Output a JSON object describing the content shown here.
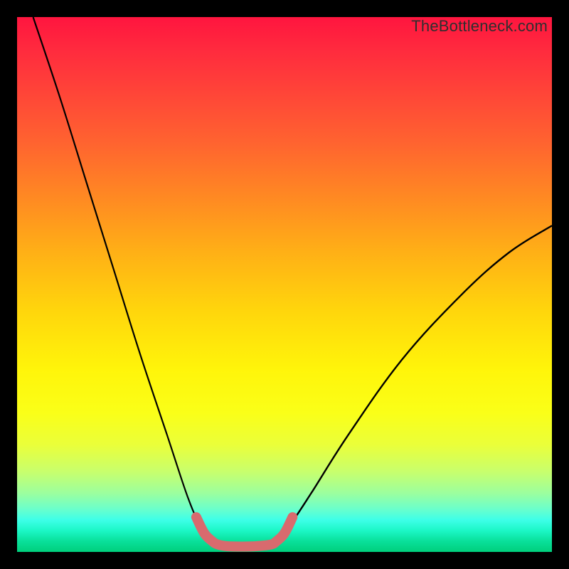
{
  "watermark": "TheBottleneck.com",
  "chart_data": {
    "type": "line",
    "title": "",
    "xlabel": "",
    "ylabel": "",
    "xlim": [
      0,
      100
    ],
    "ylim": [
      0,
      100
    ],
    "grid": false,
    "legend": false,
    "series": [
      {
        "name": "left-curve",
        "color": "#000000",
        "x": [
          3,
          8,
          13,
          18,
          23,
          28,
          32,
          34.5,
          36.5,
          37.5
        ],
        "y": [
          100,
          85,
          69,
          53,
          37,
          22,
          10,
          4.5,
          2.2,
          1.4
        ]
      },
      {
        "name": "right-curve",
        "color": "#000000",
        "x": [
          47.5,
          48.5,
          51,
          55,
          62,
          72,
          83,
          92,
          100
        ],
        "y": [
          1.4,
          2.2,
          5,
          11,
          22,
          36,
          48,
          56,
          61
        ]
      },
      {
        "name": "optimal-band",
        "color": "#d86a6e",
        "x": [
          33.5,
          35.0,
          36.5,
          37.5,
          39.0,
          42.0,
          45.0,
          47.5,
          48.5,
          50.0,
          51.5
        ],
        "y": [
          6.5,
          3.5,
          2.0,
          1.4,
          1.1,
          1.0,
          1.1,
          1.4,
          2.0,
          3.5,
          6.5
        ]
      }
    ]
  }
}
